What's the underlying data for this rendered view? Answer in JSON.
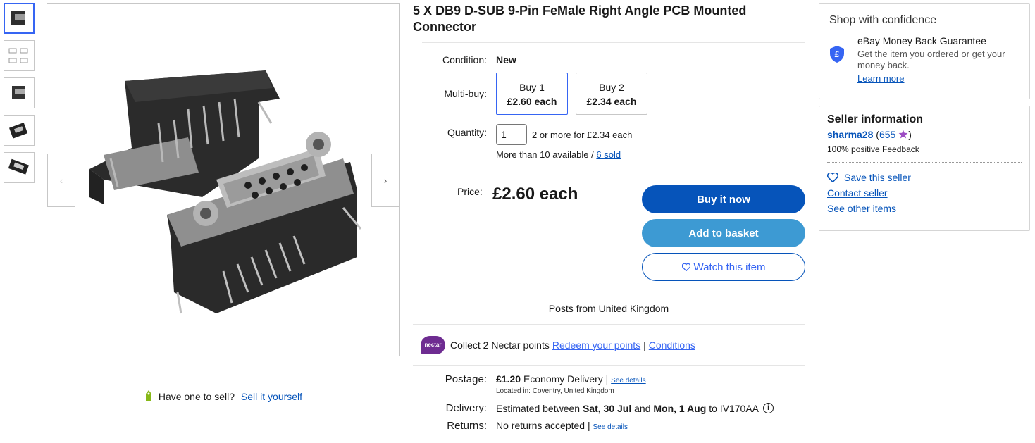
{
  "product": {
    "title": "5 X DB9 D-SUB 9-Pin FeMale Right Angle PCB Mounted Connector",
    "condition_label": "Condition:",
    "condition_value": "New",
    "multibuy_label": "Multi-buy:",
    "multibuy": [
      {
        "qty": "Buy 1",
        "price": "£2.60 each"
      },
      {
        "qty": "Buy 2",
        "price": "£2.34 each"
      }
    ],
    "quantity_label": "Quantity:",
    "quantity_value": "1",
    "quantity_note": "2 or more for £2.34 each",
    "available_text": "More than 10 available /",
    "sold_text": "6 sold",
    "price_label": "Price:",
    "price_value": "£2.60 each"
  },
  "buttons": {
    "buy_now": "Buy it now",
    "add_basket": "Add to basket",
    "watch": "Watch this item"
  },
  "shipping": {
    "posts_from": "Posts from United Kingdom",
    "nectar_logo": "nectar",
    "nectar_text": "Collect 2 Nectar points",
    "nectar_redeem": "Redeem your points",
    "nectar_sep": "|",
    "nectar_conditions": "Conditions",
    "postage_label": "Postage:",
    "postage_price": "£1.20",
    "postage_method": "Economy Delivery |",
    "postage_details": "See details",
    "location": "Located in: Coventry, United Kingdom",
    "delivery_label": "Delivery:",
    "delivery_prefix": "Estimated between",
    "delivery_date1": "Sat, 30 Jul",
    "delivery_and": "and",
    "delivery_date2": "Mon, 1 Aug",
    "delivery_to": "to IV170AA",
    "returns_label": "Returns:",
    "returns_text": "No returns accepted |",
    "returns_details": "See details"
  },
  "confidence": {
    "title": "Shop with confidence",
    "guarantee_title": "eBay Money Back Guarantee",
    "guarantee_text": "Get the item you ordered or get your money back.",
    "learn_more": "Learn more",
    "icon": "shield-pound-icon"
  },
  "seller": {
    "title": "Seller information",
    "name": "sharma28",
    "open_paren": "(",
    "score": "655",
    "close_paren": ")",
    "feedback": "100% positive Feedback",
    "save": "Save this seller",
    "contact": "Contact seller",
    "other": "See other items"
  },
  "sell": {
    "question": "Have one to sell?",
    "link": "Sell it yourself"
  },
  "image": {
    "prev_arrow": "‹",
    "next_arrow": "›"
  },
  "colors": {
    "primary": "#0654ba",
    "secondary": "#3d9ad3",
    "link_blue": "#3665f3",
    "nectar_purple": "#6e2c91",
    "star_purple": "#9d4dc4"
  }
}
